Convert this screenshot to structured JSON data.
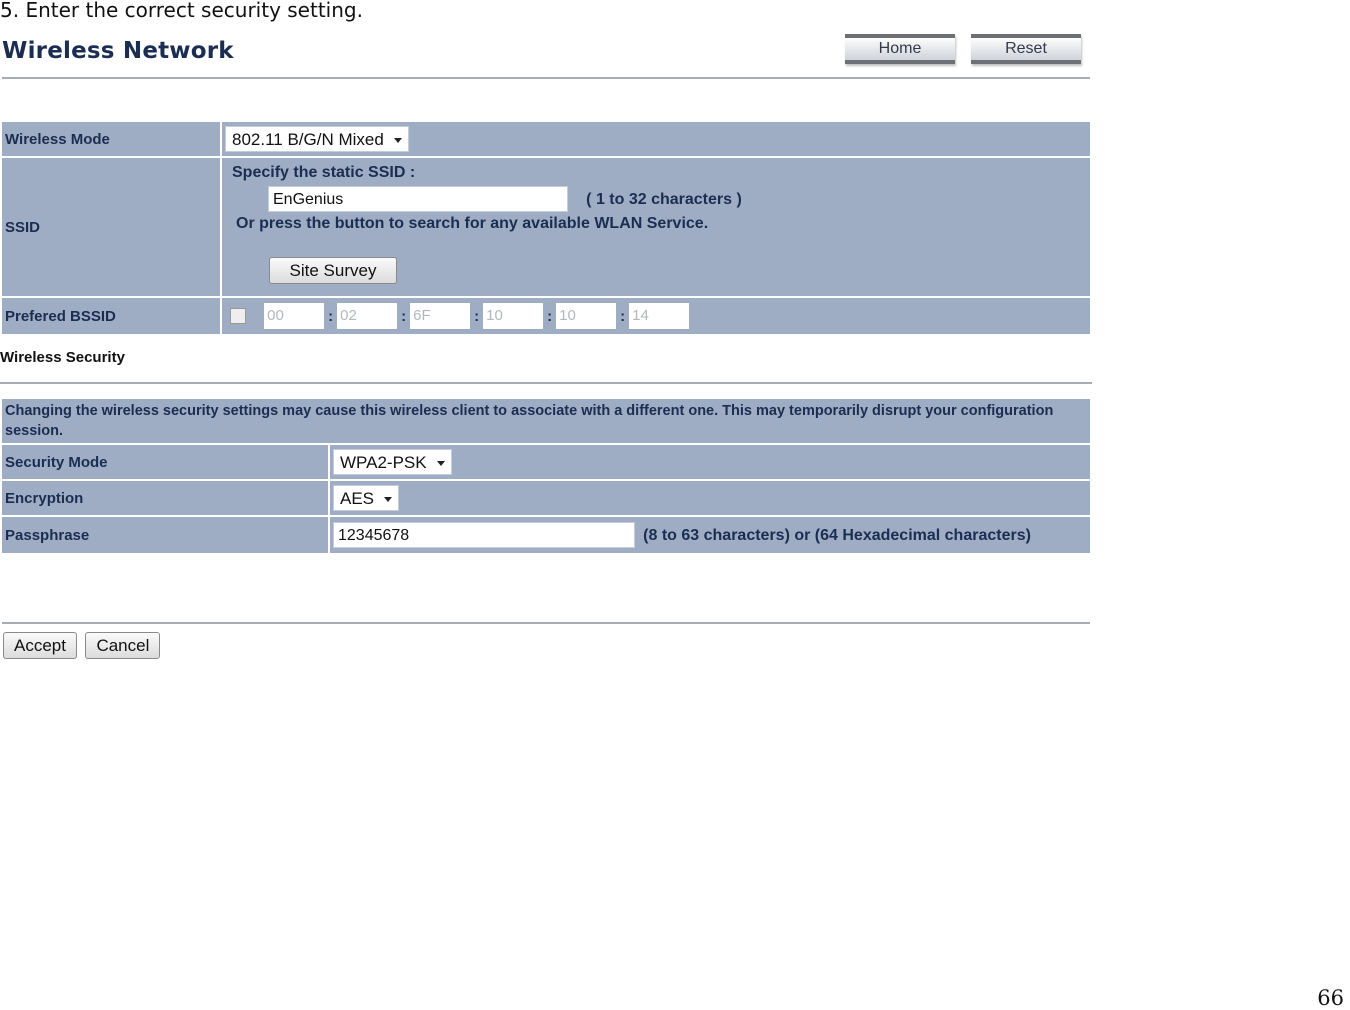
{
  "step_instruction": "5. Enter the correct security setting.",
  "header": {
    "title": "Wireless Network",
    "home_label": "Home",
    "reset_label": "Reset"
  },
  "wireless": {
    "mode_label": "Wireless Mode",
    "mode_value": "802.11 B/G/N Mixed",
    "ssid_label": "SSID",
    "ssid_specify": "Specify the static SSID  :",
    "ssid_value": "EnGenius",
    "ssid_hint": "( 1 to 32 characters )",
    "ssid_or": "Or press the button to search for any available WLAN Service.",
    "site_survey_label": "Site Survey",
    "bssid_label": "Prefered BSSID",
    "bssid_checked": false,
    "bssid_octets": [
      "00",
      "02",
      "6F",
      "10",
      "10",
      "14"
    ],
    "bssid_separator": ":"
  },
  "security": {
    "section_title": "Wireless Security",
    "warning": "Changing the wireless security settings may cause this wireless client to associate with a different one. This may temporarily disrupt your configuration session.",
    "mode_label": "Security Mode",
    "mode_value": "WPA2-PSK",
    "encryption_label": "Encryption",
    "encryption_value": "AES",
    "passphrase_label": "Passphrase",
    "passphrase_value": "12345678",
    "passphrase_hint": "(8 to 63 characters) or (64 Hexadecimal characters)"
  },
  "footer": {
    "accept_label": "Accept",
    "cancel_label": "Cancel"
  },
  "page_number": "66"
}
